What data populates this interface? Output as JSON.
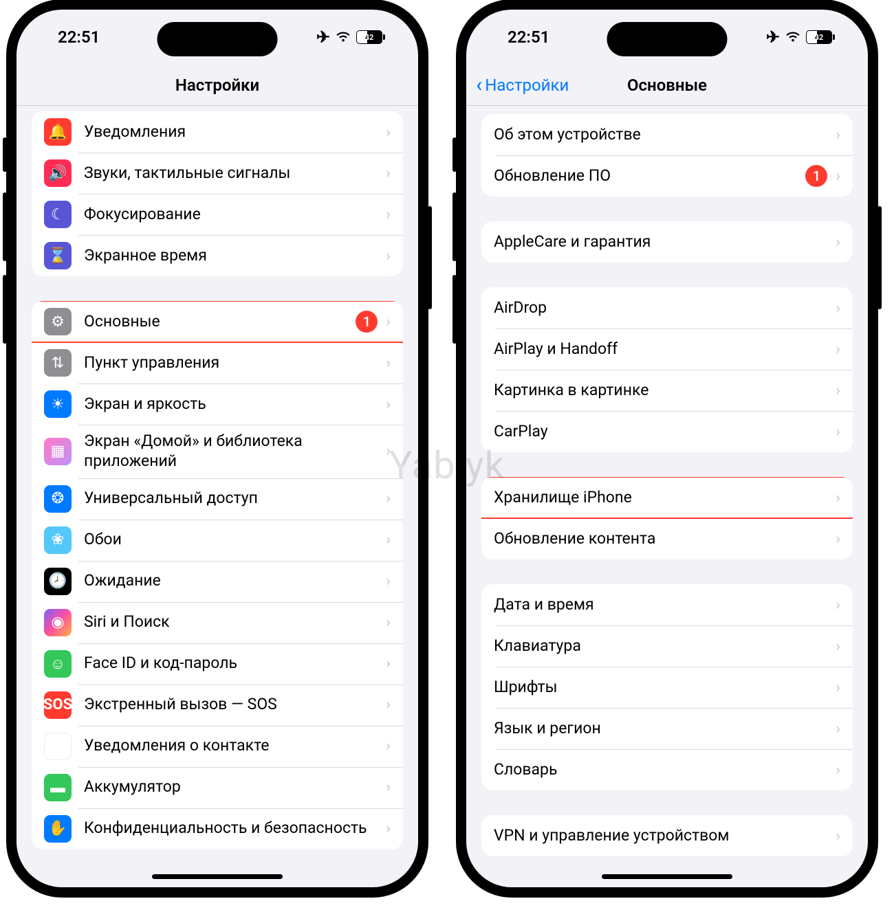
{
  "watermark": "Yablyk",
  "status": {
    "time": "22:51",
    "battery": "42"
  },
  "phone1": {
    "title": "Настройки",
    "groups": [
      {
        "rows": [
          {
            "icon": "bell-icon",
            "icon_class": "ic-red",
            "label": "Уведомления"
          },
          {
            "icon": "speaker-icon",
            "icon_class": "ic-pink",
            "label": "Звуки, тактильные сигналы"
          },
          {
            "icon": "moon-icon",
            "icon_class": "ic-indigo",
            "label": "Фокусирование"
          },
          {
            "icon": "hourglass-icon",
            "icon_class": "ic-indigo",
            "label": "Экранное время"
          }
        ]
      },
      {
        "rows": [
          {
            "icon": "gear-icon",
            "icon_class": "ic-gray",
            "label": "Основные",
            "badge": "1",
            "highlight": true
          },
          {
            "icon": "switches-icon",
            "icon_class": "ic-gray",
            "label": "Пункт управления"
          },
          {
            "icon": "brightness-icon",
            "icon_class": "ic-blue",
            "label": "Экран и яркость"
          },
          {
            "icon": "apps-icon",
            "icon_class": "ic-apps",
            "label": "Экран «Домой» и библиотека приложений"
          },
          {
            "icon": "accessibility-icon",
            "icon_class": "ic-blue",
            "label": "Универсальный доступ"
          },
          {
            "icon": "wallpaper-icon",
            "icon_class": "ic-wall",
            "label": "Обои"
          },
          {
            "icon": "standby-icon",
            "icon_class": "ic-black",
            "label": "Ожидание"
          },
          {
            "icon": "siri-icon",
            "icon_class": "ic-siri",
            "label": "Siri и Поиск"
          },
          {
            "icon": "faceid-icon",
            "icon_class": "ic-green",
            "label": "Face ID и код-пароль"
          },
          {
            "icon": "sos-icon",
            "icon_class": "ic-sos",
            "label": "Экстренный вызов — SOS"
          },
          {
            "icon": "exposure-icon",
            "icon_class": "ic-white",
            "label": "Уведомления о контакте"
          },
          {
            "icon": "battery-icon",
            "icon_class": "ic-green",
            "label": "Аккумулятор"
          },
          {
            "icon": "hand-icon",
            "icon_class": "ic-blue",
            "label": "Конфиденциальность и безопасность"
          }
        ]
      }
    ]
  },
  "phone2": {
    "back": "Настройки",
    "title": "Основные",
    "groups": [
      {
        "rows": [
          {
            "label": "Об этом устройстве"
          },
          {
            "label": "Обновление ПО",
            "badge": "1"
          }
        ]
      },
      {
        "rows": [
          {
            "label": "AppleCare и гарантия"
          }
        ]
      },
      {
        "rows": [
          {
            "label": "AirDrop"
          },
          {
            "label": "AirPlay и Handoff"
          },
          {
            "label": "Картинка в картинке"
          },
          {
            "label": "CarPlay"
          }
        ]
      },
      {
        "rows": [
          {
            "label": "Хранилище iPhone",
            "highlight": true
          },
          {
            "label": "Обновление контента"
          }
        ]
      },
      {
        "rows": [
          {
            "label": "Дата и время"
          },
          {
            "label": "Клавиатура"
          },
          {
            "label": "Шрифты"
          },
          {
            "label": "Язык и регион"
          },
          {
            "label": "Словарь"
          }
        ]
      },
      {
        "rows": [
          {
            "label": "VPN и управление устройством"
          }
        ]
      }
    ]
  },
  "icons": {
    "bell-icon": "🔔",
    "speaker-icon": "🔊",
    "moon-icon": "☾",
    "hourglass-icon": "⌛",
    "gear-icon": "⚙",
    "switches-icon": "⇅",
    "brightness-icon": "☀",
    "apps-icon": "▦",
    "accessibility-icon": "❂",
    "wallpaper-icon": "❀",
    "standby-icon": "🕗",
    "siri-icon": "◉",
    "faceid-icon": "☺",
    "sos-icon": "SOS",
    "exposure-icon": "☀",
    "battery-icon": "▬",
    "hand-icon": "✋"
  }
}
